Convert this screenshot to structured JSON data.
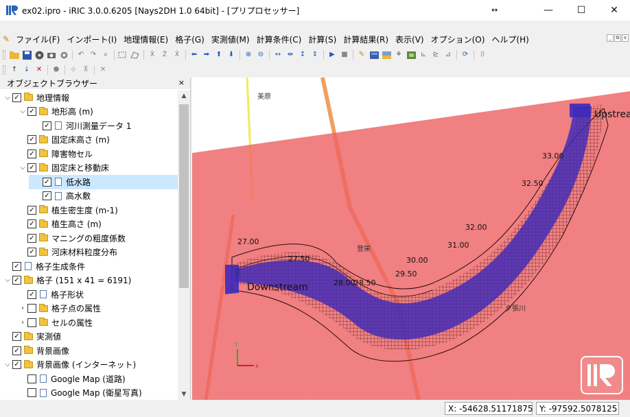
{
  "window": {
    "title": "ex02.ipro - iRIC 3.0.0.6205 [Nays2DH 1.0 64bit] - [プリプロセッサー]",
    "minimize": "—",
    "maximize": "☐",
    "close": "✕",
    "drag_glyph": "↔"
  },
  "menu": {
    "items": [
      "ファイル(F)",
      "インポート(I)",
      "地理情報(E)",
      "格子(G)",
      "実測値(M)",
      "計算条件(C)",
      "計算(S)",
      "計算結果(R)",
      "表示(V)",
      "オプション(O)",
      "ヘルプ(H)"
    ],
    "mdi_controls": [
      "_",
      "⧉",
      "x"
    ]
  },
  "browser": {
    "title": "オブジェクトブラウザー",
    "close": "×",
    "items": [
      {
        "label": "地理情報",
        "level": 0,
        "expand": "open",
        "checked": true,
        "icon": "folder"
      },
      {
        "label": "地形高 (m)",
        "level": 1,
        "expand": "open",
        "checked": true,
        "icon": "folder"
      },
      {
        "label": "河川測量データ 1",
        "level": 2,
        "expand": "",
        "checked": true,
        "icon": "doc"
      },
      {
        "label": "固定床高さ (m)",
        "level": 1,
        "expand": "",
        "checked": true,
        "icon": "folder"
      },
      {
        "label": "障害物セル",
        "level": 1,
        "expand": "",
        "checked": true,
        "icon": "folder"
      },
      {
        "label": "固定床と移動床",
        "level": 1,
        "expand": "open",
        "checked": true,
        "icon": "folder"
      },
      {
        "label": "低水路",
        "level": 2,
        "expand": "",
        "checked": true,
        "icon": "doc",
        "selected": true
      },
      {
        "label": "高水敷",
        "level": 2,
        "expand": "",
        "checked": true,
        "icon": "doc"
      },
      {
        "label": "植生密生度 (m-1)",
        "level": 1,
        "expand": "",
        "checked": true,
        "icon": "folder"
      },
      {
        "label": "植生高さ (m)",
        "level": 1,
        "expand": "",
        "checked": true,
        "icon": "folder"
      },
      {
        "label": "マニングの粗度係数",
        "level": 1,
        "expand": "",
        "checked": true,
        "icon": "folder"
      },
      {
        "label": "河床材料粒度分布",
        "level": 1,
        "expand": "",
        "checked": true,
        "icon": "folder"
      },
      {
        "label": "格子生成条件",
        "level": 0,
        "expand": "",
        "checked": true,
        "icon": "doc"
      },
      {
        "label": "格子 (151 x 41 = 6191)",
        "level": 0,
        "expand": "open",
        "checked": true,
        "icon": "folder"
      },
      {
        "label": "格子形状",
        "level": 1,
        "expand": "",
        "checked": true,
        "icon": "doc"
      },
      {
        "label": "格子点の属性",
        "level": 1,
        "expand": "closed",
        "checked": false,
        "icon": "folder"
      },
      {
        "label": "セルの属性",
        "level": 1,
        "expand": "closed",
        "checked": false,
        "icon": "folder"
      },
      {
        "label": "実測値",
        "level": 0,
        "expand": "",
        "checked": true,
        "icon": "folder"
      },
      {
        "label": "背景画像",
        "level": 0,
        "expand": "",
        "checked": true,
        "icon": "folder"
      },
      {
        "label": "背景画像 (インターネット)",
        "level": 0,
        "expand": "open",
        "checked": true,
        "icon": "folder"
      },
      {
        "label": "Google Map (道路)",
        "level": 1,
        "expand": "",
        "checked": false,
        "icon": "doc"
      },
      {
        "label": "Google Map (衛星写真)",
        "level": 1,
        "expand": "",
        "checked": false,
        "icon": "doc"
      }
    ]
  },
  "map": {
    "labels": {
      "downstream": "Downstream",
      "upstream": "Upstrea",
      "place_a": "美原",
      "place_b": "江",
      "place_c": "登栄",
      "place_d": "夕張川",
      "axis_x": "x",
      "axis_y": "Y"
    },
    "contours": [
      "27.00",
      "27.50",
      "28.00",
      "28.50",
      "29.50",
      "30.00",
      "31.00",
      "32.00",
      "32.50",
      "33.00"
    ],
    "colors": {
      "overlay": "#ee5f63",
      "channel": "#3e2ab8",
      "mesh": "#3a1a1a"
    }
  },
  "status": {
    "x": "X: -54628.51171875",
    "y": "Y: -97592.5078125"
  }
}
